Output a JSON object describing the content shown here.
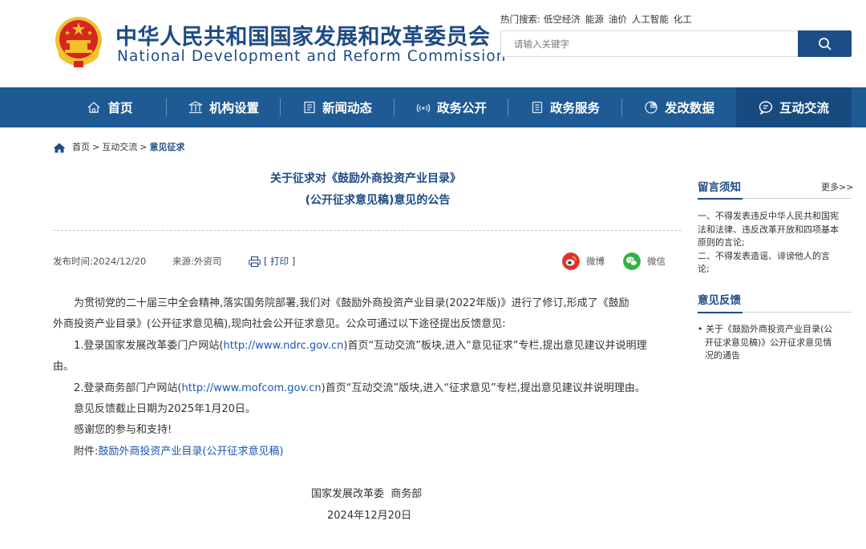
{
  "header": {
    "title_cn": "中华人民共和国国家发展和改革委员会",
    "title_en": "National Development and Reform Commission",
    "hot_label": "热门搜索:",
    "hot_terms": [
      "低空经济",
      "能源",
      "油价",
      "人工智能",
      "化工"
    ],
    "search_placeholder": "请输入关键字",
    "colors": {
      "brand_blue": "#1e4b86",
      "nav_blue": "#1e5a93",
      "emblem_red": "#d8251e",
      "emblem_gold": "#f2c12e"
    }
  },
  "nav": {
    "items": [
      {
        "label": "首页",
        "icon": "home-icon"
      },
      {
        "label": "机构设置",
        "icon": "institution-icon"
      },
      {
        "label": "新闻动态",
        "icon": "news-icon"
      },
      {
        "label": "政务公开",
        "icon": "broadcast-icon"
      },
      {
        "label": "政务服务",
        "icon": "document-icon"
      },
      {
        "label": "发改数据",
        "icon": "pie-chart-icon"
      },
      {
        "label": "互动交流",
        "icon": "chat-icon"
      }
    ],
    "active": "互动交流"
  },
  "breadcrumb": {
    "items": [
      "首页",
      "互动交流",
      "意见征求"
    ],
    "sep": ">"
  },
  "article": {
    "title_line1": "关于征求对《鼓励外商投资产业目录》",
    "title_line2": "(公开征求意见稿)意见的公告",
    "publish_date": "发布时间:2024/12/20",
    "source": "来源:外资司",
    "print": "[ 打印 ]",
    "share_weibo": "微博",
    "share_wechat": "微信",
    "para1_line1": "为贯彻党的二十届三中全会精神,落实国务院部署,我们对《鼓励外商投资产业目录(2022年版)》进行了修订,形成了《鼓励",
    "para1_line2": "外商投资产业目录》(公开征求意见稿),现向社会公开征求意见。公众可通过以下途径提出反馈意见:",
    "item1_pre": "1.登录国家发展改革委门户网站(",
    "item1_link": "http://www.ndrc.gov.cn",
    "item1_post": ")首页“互动交流”板块,进入“意见征求”专栏,提出意见建议并说明理",
    "item1_line2": "由。",
    "item2_pre": "2.登录商务部门户网站(",
    "item2_link": "http://www.mofcom.gov.cn",
    "item2_post": ")首页“互动交流”版块,进入“征求意见”专栏,提出意见建议并说明理由。",
    "deadline": "意见反馈截止日期为2025年1月20日。",
    "thanks": "感谢您的参与和支持!",
    "attach_label": "附件:",
    "attach_link": "鼓励外商投资产业目录(公开征求意见稿)",
    "signature": "国家发展改革委  商务部",
    "sign_date": "2024年12月20日"
  },
  "sidebar": {
    "notice_title": "留言须知",
    "more": "更多>>",
    "notice_lines": [
      "一、不得发表违反中华人民共和国宪",
      "法和法律、违反改革开放和四项基本",
      "原则的言论;",
      "二、不得发表造谣、诽谤他人的言",
      "论;"
    ],
    "feedback_title": "意见反馈",
    "feedback_lines": [
      "• 关于《鼓励外商投资产业目录(公",
      "开征求意见稿)》公开征求意见情",
      "况的通告"
    ]
  }
}
